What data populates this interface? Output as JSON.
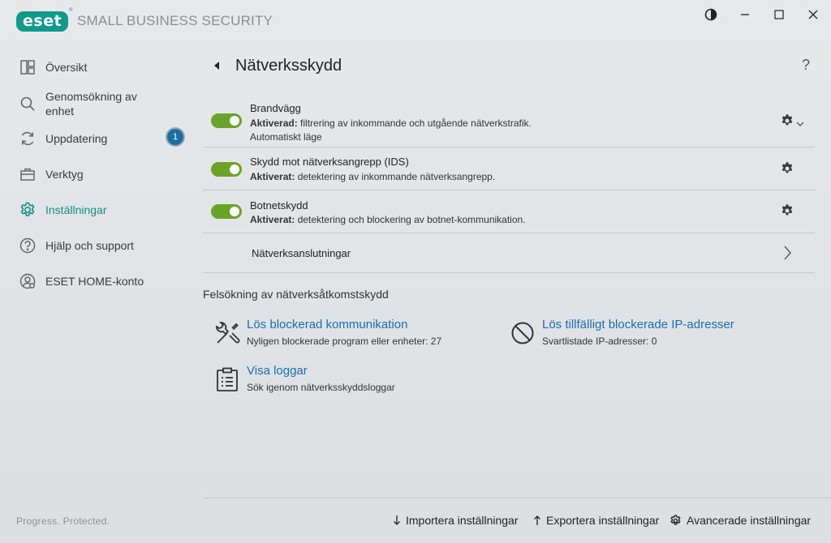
{
  "app": {
    "logo_text": "eset",
    "logo_tm": "®",
    "product": "SMALL BUSINESS SECURITY",
    "tagline": "Progress. Protected."
  },
  "window_controls": [
    "contrast-icon",
    "minimize-icon",
    "maximize-icon",
    "close-icon"
  ],
  "sidebar": {
    "items": [
      {
        "label": "Översikt",
        "icon": "overview-icon"
      },
      {
        "label": "Genomsökning av enhet",
        "icon": "search-icon"
      },
      {
        "label": "Uppdatering",
        "icon": "refresh-icon",
        "badge": "1"
      },
      {
        "label": "Verktyg",
        "icon": "briefcase-icon"
      },
      {
        "label": "Inställningar",
        "icon": "gear-icon",
        "active": true
      },
      {
        "label": "Hjälp och support",
        "icon": "help-icon"
      },
      {
        "label": "ESET HOME-konto",
        "icon": "account-icon"
      }
    ]
  },
  "page": {
    "title": "Nätverksskydd",
    "help": "?"
  },
  "modules": [
    {
      "title": "Brandvägg",
      "status": "Aktiverad:",
      "desc": "filtrering av inkommande och utgående nätverkstrafik.",
      "sub": "Automatiskt läge",
      "enabled": true
    },
    {
      "title": "Skydd mot nätverksangrepp (IDS)",
      "status": "Aktiverat:",
      "desc": "detektering av inkommande nätverksangrepp.",
      "enabled": true
    },
    {
      "title": "Botnetskydd",
      "status": "Aktiverat:",
      "desc": "detektering och blockering av botnet-kommunikation.",
      "enabled": true
    }
  ],
  "connections": {
    "label": "Nätverksanslutningar"
  },
  "troubleshoot": {
    "title": "Felsökning av nätverksåtkomstskydd",
    "tools": [
      {
        "link": "Lös blockerad kommunikation",
        "desc": "Nyligen blockerade program eller enheter: 27",
        "icon": "tools-icon"
      },
      {
        "link": "Lös tillfälligt blockerade IP-adresser",
        "desc": "Svartlistade IP-adresser: 0",
        "icon": "block-icon"
      },
      {
        "link": "Visa loggar",
        "desc": "Sök igenom nätverksskyddsloggar",
        "icon": "clipboard-icon"
      }
    ]
  },
  "footer": {
    "import": "Importera inställningar",
    "export": "Exportera inställningar",
    "advanced": "Avancerade inställningar"
  },
  "colors": {
    "accent": "#0f9a8c",
    "toggle_on": "#6aa32a",
    "link": "#1b6eb0",
    "badge": "#1d6ea0"
  }
}
